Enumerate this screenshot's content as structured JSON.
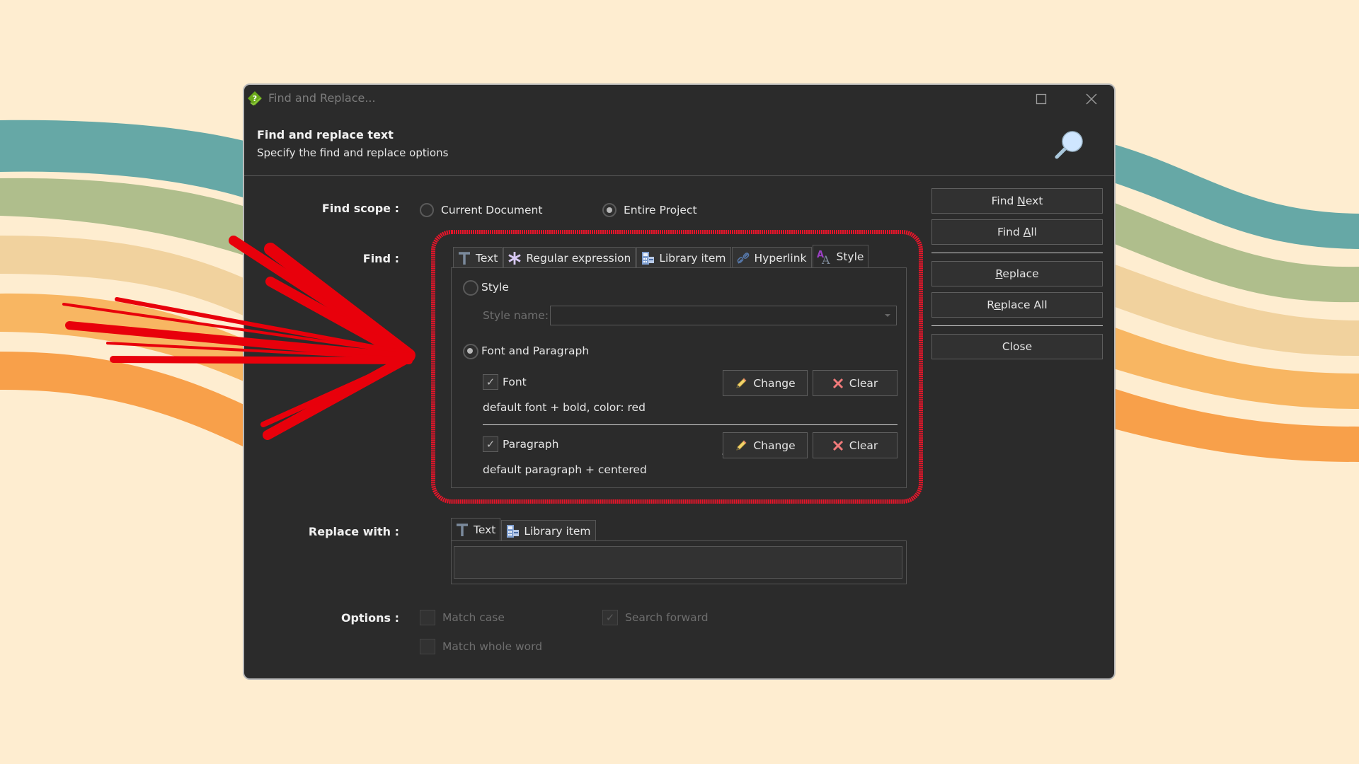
{
  "window": {
    "title": "Find and Replace...",
    "header_title": "Find and replace text",
    "header_subtitle": "Specify the find and replace options"
  },
  "scope": {
    "label": "Find scope :",
    "options": [
      {
        "label": "Current Document",
        "selected": false
      },
      {
        "label": "Entire Project",
        "selected": true
      }
    ]
  },
  "find": {
    "label": "Find :",
    "tabs": [
      {
        "label": "Text",
        "icon": "text-t-icon",
        "active": false
      },
      {
        "label": "Regular expression",
        "icon": "asterisk-icon",
        "active": false
      },
      {
        "label": "Library item",
        "icon": "library-item-icon",
        "active": false
      },
      {
        "label": "Hyperlink",
        "icon": "hyperlink-icon",
        "active": false
      },
      {
        "label": "Style",
        "icon": "style-icon",
        "active": true
      }
    ],
    "style_radio": {
      "label": "Style",
      "selected": false
    },
    "style_name_label": "Style name:",
    "style_name_value": "",
    "font_paragraph_radio": {
      "label": "Font and Paragraph",
      "selected": true
    },
    "font": {
      "label": "Font",
      "checked": true,
      "description": "default font + bold, color: red",
      "change_label": "Change",
      "clear_label": "Clear"
    },
    "paragraph": {
      "label": "Paragraph",
      "checked": true,
      "description": "default paragraph + centered",
      "change_label": "Change",
      "clear_label": "Clear"
    }
  },
  "replace": {
    "label": "Replace with :",
    "tabs": [
      {
        "label": "Text",
        "icon": "text-t-icon",
        "active": true
      },
      {
        "label": "Library item",
        "icon": "library-item-icon",
        "active": false
      }
    ],
    "value": ""
  },
  "options": {
    "label": "Options :",
    "items": [
      {
        "label": "Match case",
        "checked": false,
        "enabled": false
      },
      {
        "label": "Search forward",
        "checked": true,
        "enabled": false
      },
      {
        "label": "Match whole word",
        "checked": false,
        "enabled": false
      }
    ]
  },
  "actions": {
    "find_next": {
      "pre": "Find ",
      "mnemonic": "N",
      "post": "ext"
    },
    "find_all": {
      "pre": "Find ",
      "mnemonic": "A",
      "post": "ll"
    },
    "replace": {
      "pre": "",
      "mnemonic": "R",
      "post": "eplace"
    },
    "replace_all": {
      "pre": "R",
      "mnemonic": "e",
      "post": "place All"
    },
    "close": {
      "pre": "Close",
      "mnemonic": "",
      "post": ""
    }
  },
  "colors": {
    "background": "#feedd0",
    "dialog": "#2b2b2b",
    "annotation_red": "#e8000b",
    "waves": [
      "#66a8a6",
      "#afbe8c",
      "#f1d29e",
      "#f8b662",
      "#f8a04a"
    ]
  }
}
